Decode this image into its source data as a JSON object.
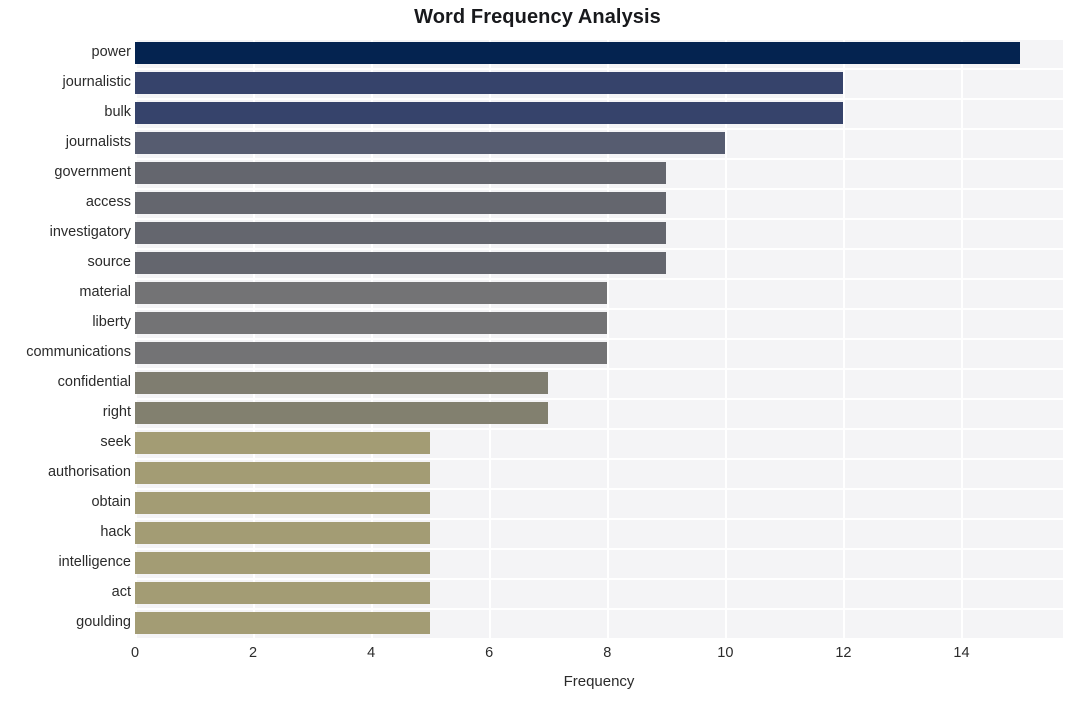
{
  "chart_data": {
    "type": "bar",
    "orientation": "horizontal",
    "title": "Word Frequency Analysis",
    "xlabel": "Frequency",
    "ylabel": "",
    "categories": [
      "power",
      "journalistic",
      "bulk",
      "journalists",
      "government",
      "access",
      "investigatory",
      "source",
      "material",
      "liberty",
      "communications",
      "confidential",
      "right",
      "seek",
      "authorisation",
      "obtain",
      "hack",
      "intelligence",
      "act",
      "goulding"
    ],
    "values": [
      15,
      12,
      12,
      10,
      9,
      9,
      9,
      9,
      8,
      8,
      8,
      7,
      7,
      5,
      5,
      5,
      5,
      5,
      5,
      5
    ],
    "bar_colors": [
      "#042350",
      "#36436b",
      "#36436b",
      "#565c70",
      "#64666e",
      "#64666e",
      "#64666e",
      "#64666e",
      "#737375",
      "#737375",
      "#737375",
      "#7f7d70",
      "#82806f",
      "#a39c74",
      "#a39c74",
      "#a39c74",
      "#a39c74",
      "#a39c74",
      "#a39c74",
      "#a39c74"
    ],
    "xticks": [
      0,
      2,
      4,
      6,
      8,
      10,
      12,
      14
    ],
    "xtick_labels": [
      "0",
      "2",
      "4",
      "6",
      "8",
      "10",
      "12",
      "14"
    ],
    "xlim": [
      0,
      15.72
    ],
    "grid": true,
    "grid_color": "#ffffff",
    "plot_background": "#f4f4f6",
    "figure_background": "#ffffff",
    "legend": null
  }
}
